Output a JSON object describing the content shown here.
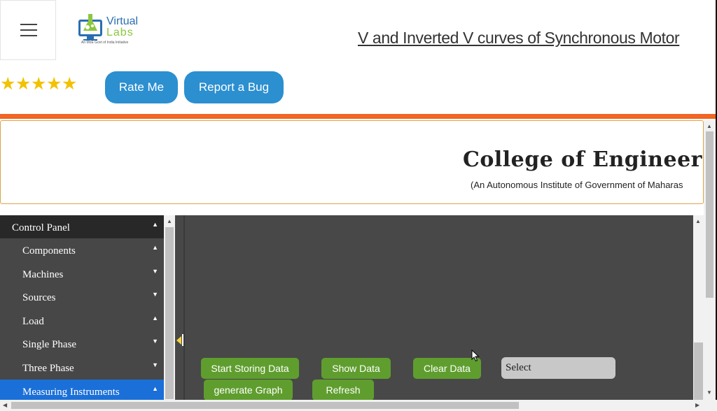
{
  "header": {
    "menu_icon": "hamburger-icon",
    "logo": {
      "text_line1": "Virtual",
      "text_line2": "Labs",
      "tagline": "An MoE Govt of India Initiative",
      "colors": {
        "blue": "#2a6fb0",
        "green": "#8cc63f"
      }
    },
    "title": "V and Inverted V curves of Synchronous Motor"
  },
  "rating": {
    "stars": 5,
    "star_glyph": "★",
    "star_color": "#f2c200"
  },
  "actions": {
    "rate_label": "Rate Me",
    "bug_label": "Report a Bug",
    "button_color": "#2b8fd0"
  },
  "accent_color": "#f26522",
  "banner": {
    "title": "College of Engineering,",
    "subtitle": "(An Autonomous Institute of Government of Maharas"
  },
  "sidebar": {
    "items": [
      {
        "label": "Control Panel",
        "caret": "▲"
      },
      {
        "label": "Components",
        "caret": "▲"
      },
      {
        "label": "Machines",
        "caret": "▼"
      },
      {
        "label": "Sources",
        "caret": "▼"
      },
      {
        "label": "Load",
        "caret": "▲"
      },
      {
        "label": "Single Phase",
        "caret": "▼"
      },
      {
        "label": "Three Phase",
        "caret": "▼"
      },
      {
        "label": "Measuring Instruments",
        "caret": "▲"
      }
    ],
    "active_color": "#1a6fd8"
  },
  "toolbar": {
    "start_label": "Start Storing Data",
    "show_label": "Show Data",
    "clear_label": "Clear Data",
    "graph_label": "generate Graph",
    "refresh_label": "Refresh",
    "select_value": "Select",
    "button_color": "#5f9e2e"
  }
}
